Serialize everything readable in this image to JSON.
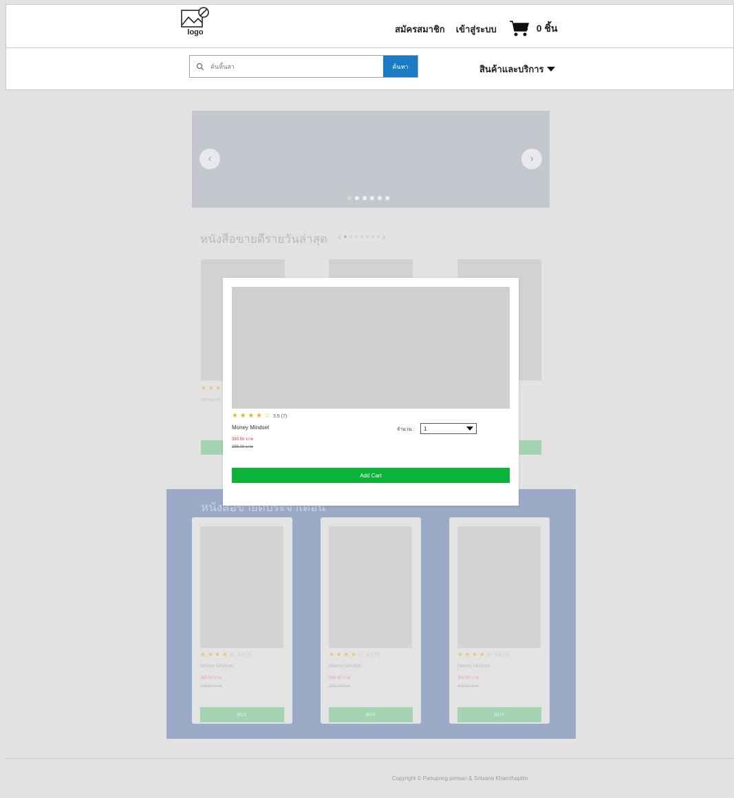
{
  "header": {
    "logo_label": "logo",
    "register": "สมัครสมาชิก",
    "login": "เข้าสู่ระบบ",
    "cart_count": "0 ชิ้น"
  },
  "search": {
    "placeholder": "ค้นหิ้นสา",
    "button": "ค้นหา"
  },
  "nav": {
    "products_menu": "สินค้าและบริการ"
  },
  "banner": {
    "prev": "‹",
    "next": "›",
    "slide_count": 6,
    "active_slide": 1
  },
  "section1": {
    "title": "หนังสือขายดีรายวันล่าสุด",
    "prev": "‹",
    "next": "›"
  },
  "section2": {
    "title": "หนังสือขายดีประจำเดือน",
    "products": [
      {
        "rating": "★ ★ ★ ★ ☆",
        "rating_count": "3.5 (7)",
        "name": "Money Mindset",
        "price": "350.50 บาท",
        "old_price": "399.00 บาท",
        "buy": "BUY"
      },
      {
        "rating": "★ ★ ★ ★ ☆",
        "rating_count": "3.5 (7)",
        "name": "Money Mindset",
        "price": "350.50 บาท",
        "old_price": "399.00 บาท",
        "buy": "BUY"
      },
      {
        "rating": "★ ★ ★ ★ ☆",
        "rating_count": "3.5 (7)",
        "name": "Money Mindset",
        "price": "350.50 บาท",
        "old_price": "399.00 บาท",
        "buy": "BUY"
      }
    ]
  },
  "modal": {
    "rating": "★ ★ ★ ★ ☆",
    "rating_count": "3.5 (7)",
    "name": "Money Mindset",
    "price": "350.50 บาท",
    "old_price": "399.00 บาท",
    "qty_label": "จำนวน :",
    "qty_value": "1",
    "add_cart": "Add Cart"
  },
  "footer": {
    "copyright": "Copyright © Panupong pimsan & Sritsana Khamthaptim"
  },
  "colors": {
    "accent_blue": "#1a7cc7",
    "add_cart_green": "#0bb33a",
    "buy_green": "#a3d3b0",
    "section_blue": "#9aaac7",
    "star": "#e4b624",
    "price_red": "#e02b3a"
  }
}
